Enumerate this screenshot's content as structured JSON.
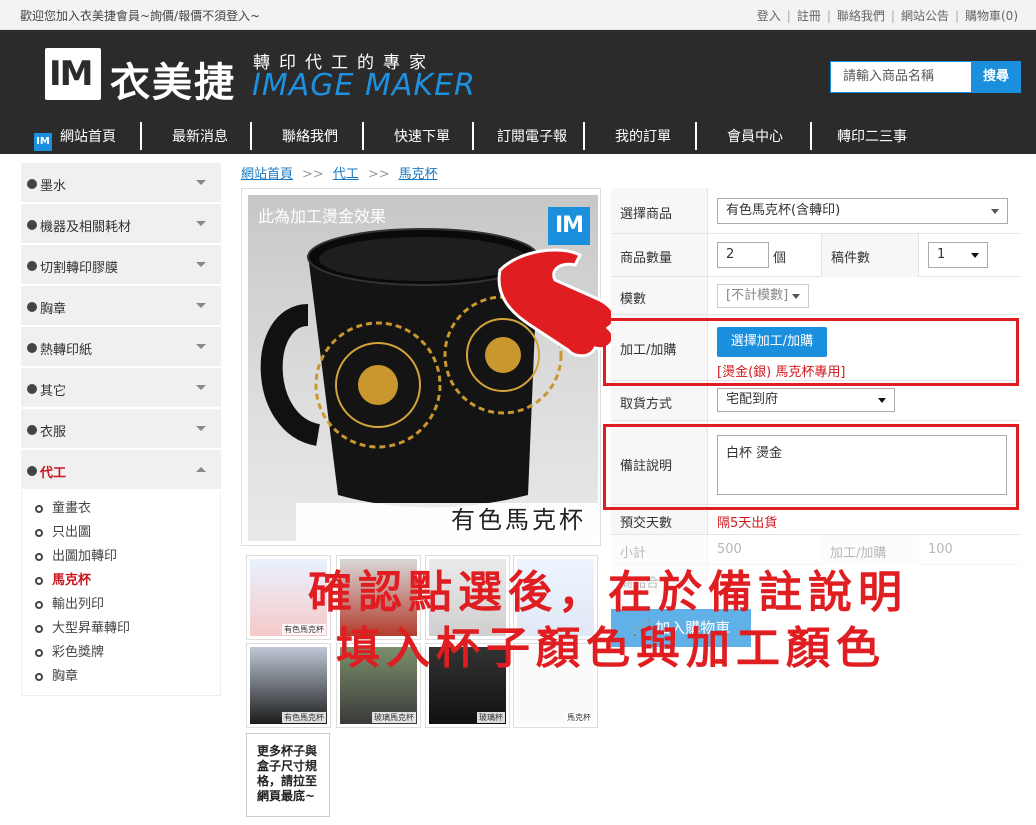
{
  "topbar": {
    "welcome": "歡迎您加入衣美捷會員~詢價/報價不須登入~",
    "links": [
      "登入",
      "註冊",
      "聯絡我們",
      "網站公告",
      "購物車(0)"
    ]
  },
  "header": {
    "logo_mark": "IM",
    "brand_cn": "衣美捷",
    "tagline": "轉印代工的專家",
    "brand_en": "IMAGE MAKER",
    "search_placeholder": "請輸入商品名稱",
    "search_button": "搜尋"
  },
  "nav": [
    "網站首頁",
    "最新消息",
    "聯絡我們",
    "快速下單",
    "訂閱電子報",
    "我的訂單",
    "會員中心",
    "轉印二三事"
  ],
  "sidebar": {
    "categories": [
      "墨水",
      "機器及相關耗材",
      "切割轉印膠膜",
      "胸章",
      "熱轉印紙",
      "其它",
      "衣服",
      "代工"
    ],
    "subitems": [
      "童畫衣",
      "只出圖",
      "出圖加轉印",
      "馬克杯",
      "輸出列印",
      "大型昇華轉印",
      "彩色獎牌",
      "胸章"
    ],
    "active_sub": "馬克杯"
  },
  "breadcrumb": [
    "網站首頁",
    "代工",
    "馬克杯"
  ],
  "breadcrumb_sep": ">>",
  "product": {
    "image_caption_top": "此為加工燙金效果",
    "image_logo": "IM",
    "image_caption": "有色馬克杯",
    "thumb_labels": [
      "有色馬克杯",
      "有色馬克杯",
      "玻璃馬克杯",
      "玻璃杯",
      "馬克杯"
    ],
    "more_note": "更多杯子與盒子尺寸規格，請拉至網頁最底~"
  },
  "form": {
    "select_product_label": "選擇商品",
    "select_product_value": "有色馬克杯(含轉印)",
    "qty_label": "商品數量",
    "qty_value": "2",
    "qty_unit": "個",
    "drafts_label": "稿件數",
    "drafts_value": "1",
    "template_label": "模數",
    "template_value": "[不計模數]",
    "process_label": "加工/加購",
    "process_button": "選擇加工/加購",
    "process_selected": "[燙金(銀) 馬克杯專用]",
    "shipping_label": "取貨方式",
    "shipping_value": "宅配到府",
    "note_label": "備註說明",
    "note_value": "白杯 燙金",
    "days_label": "預交天數",
    "days_value": "隔5天出貨",
    "subtotal_label": "小計",
    "subtotal_value": "500",
    "process_fee_label": "加工/加購",
    "process_fee_value": "100",
    "total_label": "商品合",
    "cart_button": "加入購物車"
  },
  "overlay": {
    "line1": "確認點選後，在於備註說明",
    "line2": "填入杯子顏色與加工顏色"
  },
  "colors": {
    "brand_blue": "#1a8fdd",
    "header_bg": "#2b2b2b",
    "highlight_red": "#e01d21"
  }
}
